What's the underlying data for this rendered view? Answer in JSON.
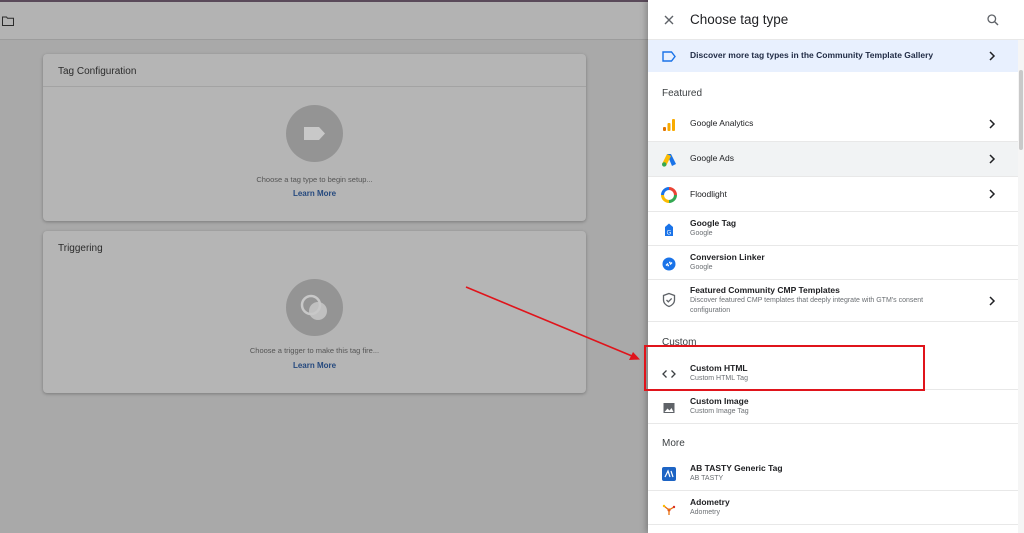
{
  "editor": {
    "tag_config": {
      "title": "Tag Configuration",
      "hint": "Choose a tag type to begin setup...",
      "learn_more": "Learn More"
    },
    "triggering": {
      "title": "Triggering",
      "hint": "Choose a trigger to make this tag fire...",
      "learn_more": "Learn More"
    }
  },
  "panel": {
    "title": "Choose tag type",
    "discover": "Discover more tag types in the Community Template Gallery",
    "sections": {
      "featured": "Featured",
      "custom": "Custom",
      "more": "More"
    },
    "featured_items": [
      {
        "title": "Google Analytics"
      },
      {
        "title": "Google Ads"
      },
      {
        "title": "Floodlight"
      },
      {
        "title": "Google Tag",
        "sub": "Google"
      },
      {
        "title": "Conversion Linker",
        "sub": "Google"
      },
      {
        "title": "Featured Community CMP Templates",
        "sub": "Discover featured CMP templates that deeply integrate with GTM's consent configuration"
      }
    ],
    "custom_items": [
      {
        "title": "Custom HTML",
        "sub": "Custom HTML Tag",
        "icon": "code-brackets-icon"
      },
      {
        "title": "Custom Image",
        "sub": "Custom Image Tag",
        "icon": "image-icon"
      }
    ],
    "more_items": [
      {
        "title": "AB TASTY Generic Tag",
        "sub": "AB TASTY"
      },
      {
        "title": "Adometry",
        "sub": "Adometry"
      }
    ]
  },
  "colors": {
    "accent_blue": "#1a73e8",
    "highlight_red": "#e0141b",
    "link_blue": "#25497e"
  }
}
